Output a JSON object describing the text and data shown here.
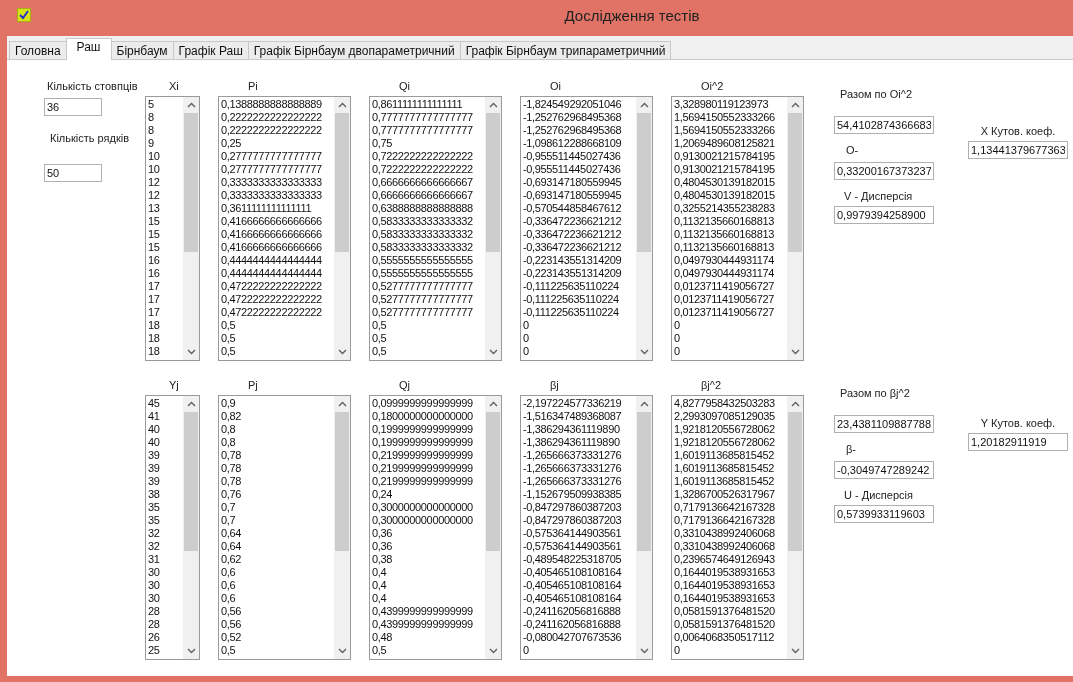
{
  "window": {
    "title": "Дослідження тестів"
  },
  "tabs": [
    {
      "label": "Головна",
      "selected": false
    },
    {
      "label": "Раш",
      "selected": true
    },
    {
      "label": "Бірнбаум",
      "selected": false
    },
    {
      "label": "Графік Раш",
      "selected": false
    },
    {
      "label": "Графік Бірнбаум двопараметричний",
      "selected": false
    },
    {
      "label": "Графік Бірнбаум трипараметричний",
      "selected": false
    }
  ],
  "settings": {
    "columns_label": "Кількість стовпців",
    "columns_value": "36",
    "rows_label": "Кількість рядків",
    "rows_value": "50"
  },
  "sections": [
    {
      "lists": [
        {
          "header": "Xi",
          "items": [
            "5",
            "8",
            "8",
            "9",
            "10",
            "10",
            "12",
            "12",
            "13",
            "15",
            "15",
            "15",
            "16",
            "16",
            "17",
            "17",
            "17",
            "18",
            "18",
            "18"
          ]
        },
        {
          "header": "Pi",
          "items": [
            "0,1388888888888889",
            "0,2222222222222222",
            "0,2222222222222222",
            "0,25",
            "0,2777777777777777",
            "0,2777777777777777",
            "0,3333333333333333",
            "0,3333333333333333",
            "0,3611111111111111",
            "0,4166666666666666",
            "0,4166666666666666",
            "0,4166666666666666",
            "0,4444444444444444",
            "0,4444444444444444",
            "0,4722222222222222",
            "0,4722222222222222",
            "0,4722222222222222",
            "0,5",
            "0,5",
            "0,5"
          ]
        },
        {
          "header": "Qi",
          "items": [
            "0,8611111111111111",
            "0,7777777777777777",
            "0,7777777777777777",
            "0,75",
            "0,7222222222222222",
            "0,7222222222222222",
            "0,6666666666666667",
            "0,6666666666666667",
            "0,6388888888888888",
            "0,5833333333333332",
            "0,5833333333333332",
            "0,5833333333333332",
            "0,5555555555555555",
            "0,5555555555555555",
            "0,5277777777777777",
            "0,5277777777777777",
            "0,5277777777777777",
            "0,5",
            "0,5",
            "0,5"
          ]
        },
        {
          "header": "Oi",
          "items": [
            "-1,824549292051046",
            "-1,252762968495368",
            "-1,252762968495368",
            "-1,098612288668109",
            "-0,955511445027436",
            "-0,955511445027436",
            "-0,693147180559945",
            "-0,693147180559945",
            "-0,570544858467612",
            "-0,336472236621212",
            "-0,336472236621212",
            "-0,336472236621212",
            "-0,223143551314209",
            "-0,223143551314209",
            "-0,111225635110224",
            "-0,111225635110224",
            "-0,111225635110224",
            "0",
            "0",
            "0"
          ]
        },
        {
          "header": "Oi^2",
          "items": [
            "3,328980119123973",
            "1,5694150552333266",
            "1,5694150552333266",
            "1,2069489608125821",
            "0,9130021215784195",
            "0,9130021215784195",
            "0,4804530139182015",
            "0,4804530139182015",
            "0,3255214355238283",
            "0,1132135660168813",
            "0,1132135660168813",
            "0,1132135660168813",
            "0,0497930444931174",
            "0,0497930444931174",
            "0,0123711419056727",
            "0,0123711419056727",
            "0,0123711419056727",
            "0",
            "0",
            "0"
          ]
        }
      ],
      "sum_label": "Разом по Oi^2",
      "sum_value": "54,4102874366683",
      "mean_label": "O-",
      "mean_value": "0,33200167373237",
      "variance_label": "V - Дисперсія",
      "variance_value": "0,9979394258900",
      "coef_label": "X Кутов. коеф.",
      "coef_value": "1,13441379677363"
    },
    {
      "lists": [
        {
          "header": "Yj",
          "items": [
            "45",
            "41",
            "40",
            "40",
            "39",
            "39",
            "39",
            "38",
            "35",
            "35",
            "32",
            "32",
            "31",
            "30",
            "30",
            "30",
            "28",
            "28",
            "26",
            "25"
          ]
        },
        {
          "header": "Pj",
          "items": [
            "0,9",
            "0,82",
            "0,8",
            "0,8",
            "0,78",
            "0,78",
            "0,78",
            "0,76",
            "0,7",
            "0,7",
            "0,64",
            "0,64",
            "0,62",
            "0,6",
            "0,6",
            "0,6",
            "0,56",
            "0,56",
            "0,52",
            "0,5"
          ]
        },
        {
          "header": "Qj",
          "items": [
            "0,0999999999999999",
            "0,1800000000000000",
            "0,1999999999999999",
            "0,1999999999999999",
            "0,2199999999999999",
            "0,2199999999999999",
            "0,2199999999999999",
            "0,24",
            "0,3000000000000000",
            "0,3000000000000000",
            "0,36",
            "0,36",
            "0,38",
            "0,4",
            "0,4",
            "0,4",
            "0,4399999999999999",
            "0,4399999999999999",
            "0,48",
            "0,5"
          ]
        },
        {
          "header": "βj",
          "items": [
            "-2,197224577336219",
            "-1,516347489368087",
            "-1,386294361119890",
            "-1,386294361119890",
            "-1,265666373331276",
            "-1,265666373331276",
            "-1,265666373331276",
            "-1,152679509938385",
            "-0,847297860387203",
            "-0,847297860387203",
            "-0,575364144903561",
            "-0,575364144903561",
            "-0,489548225318705",
            "-0,405465108108164",
            "-0,405465108108164",
            "-0,405465108108164",
            "-0,241162056816888",
            "-0,241162056816888",
            "-0,080042707673536",
            "0"
          ]
        },
        {
          "header": "βj^2",
          "items": [
            "4,8277958432503283",
            "2,2993097085129035",
            "1,9218120556728062",
            "1,9218120556728062",
            "1,6019113685815452",
            "1,6019113685815452",
            "1,6019113685815452",
            "1,3286700526317967",
            "0,7179136642167328",
            "0,7179136642167328",
            "0,3310438992406068",
            "0,3310438992406068",
            "0,2396574649126943",
            "0,1644019538931653",
            "0,1644019538931653",
            "0,1644019538931653",
            "0,0581591376481520",
            "0,0581591376481520",
            "0,0064068350517112",
            "0"
          ]
        }
      ],
      "sum_label": "Разом по βj^2",
      "sum_value": "23,4381109887788",
      "mean_label": "β-",
      "mean_value": "-0,3049747289242",
      "variance_label": "U - Дисперсія",
      "variance_value": "0,5739933119603",
      "coef_label": "Y Кутов. коеф.",
      "coef_value": "1,20182911919"
    }
  ]
}
